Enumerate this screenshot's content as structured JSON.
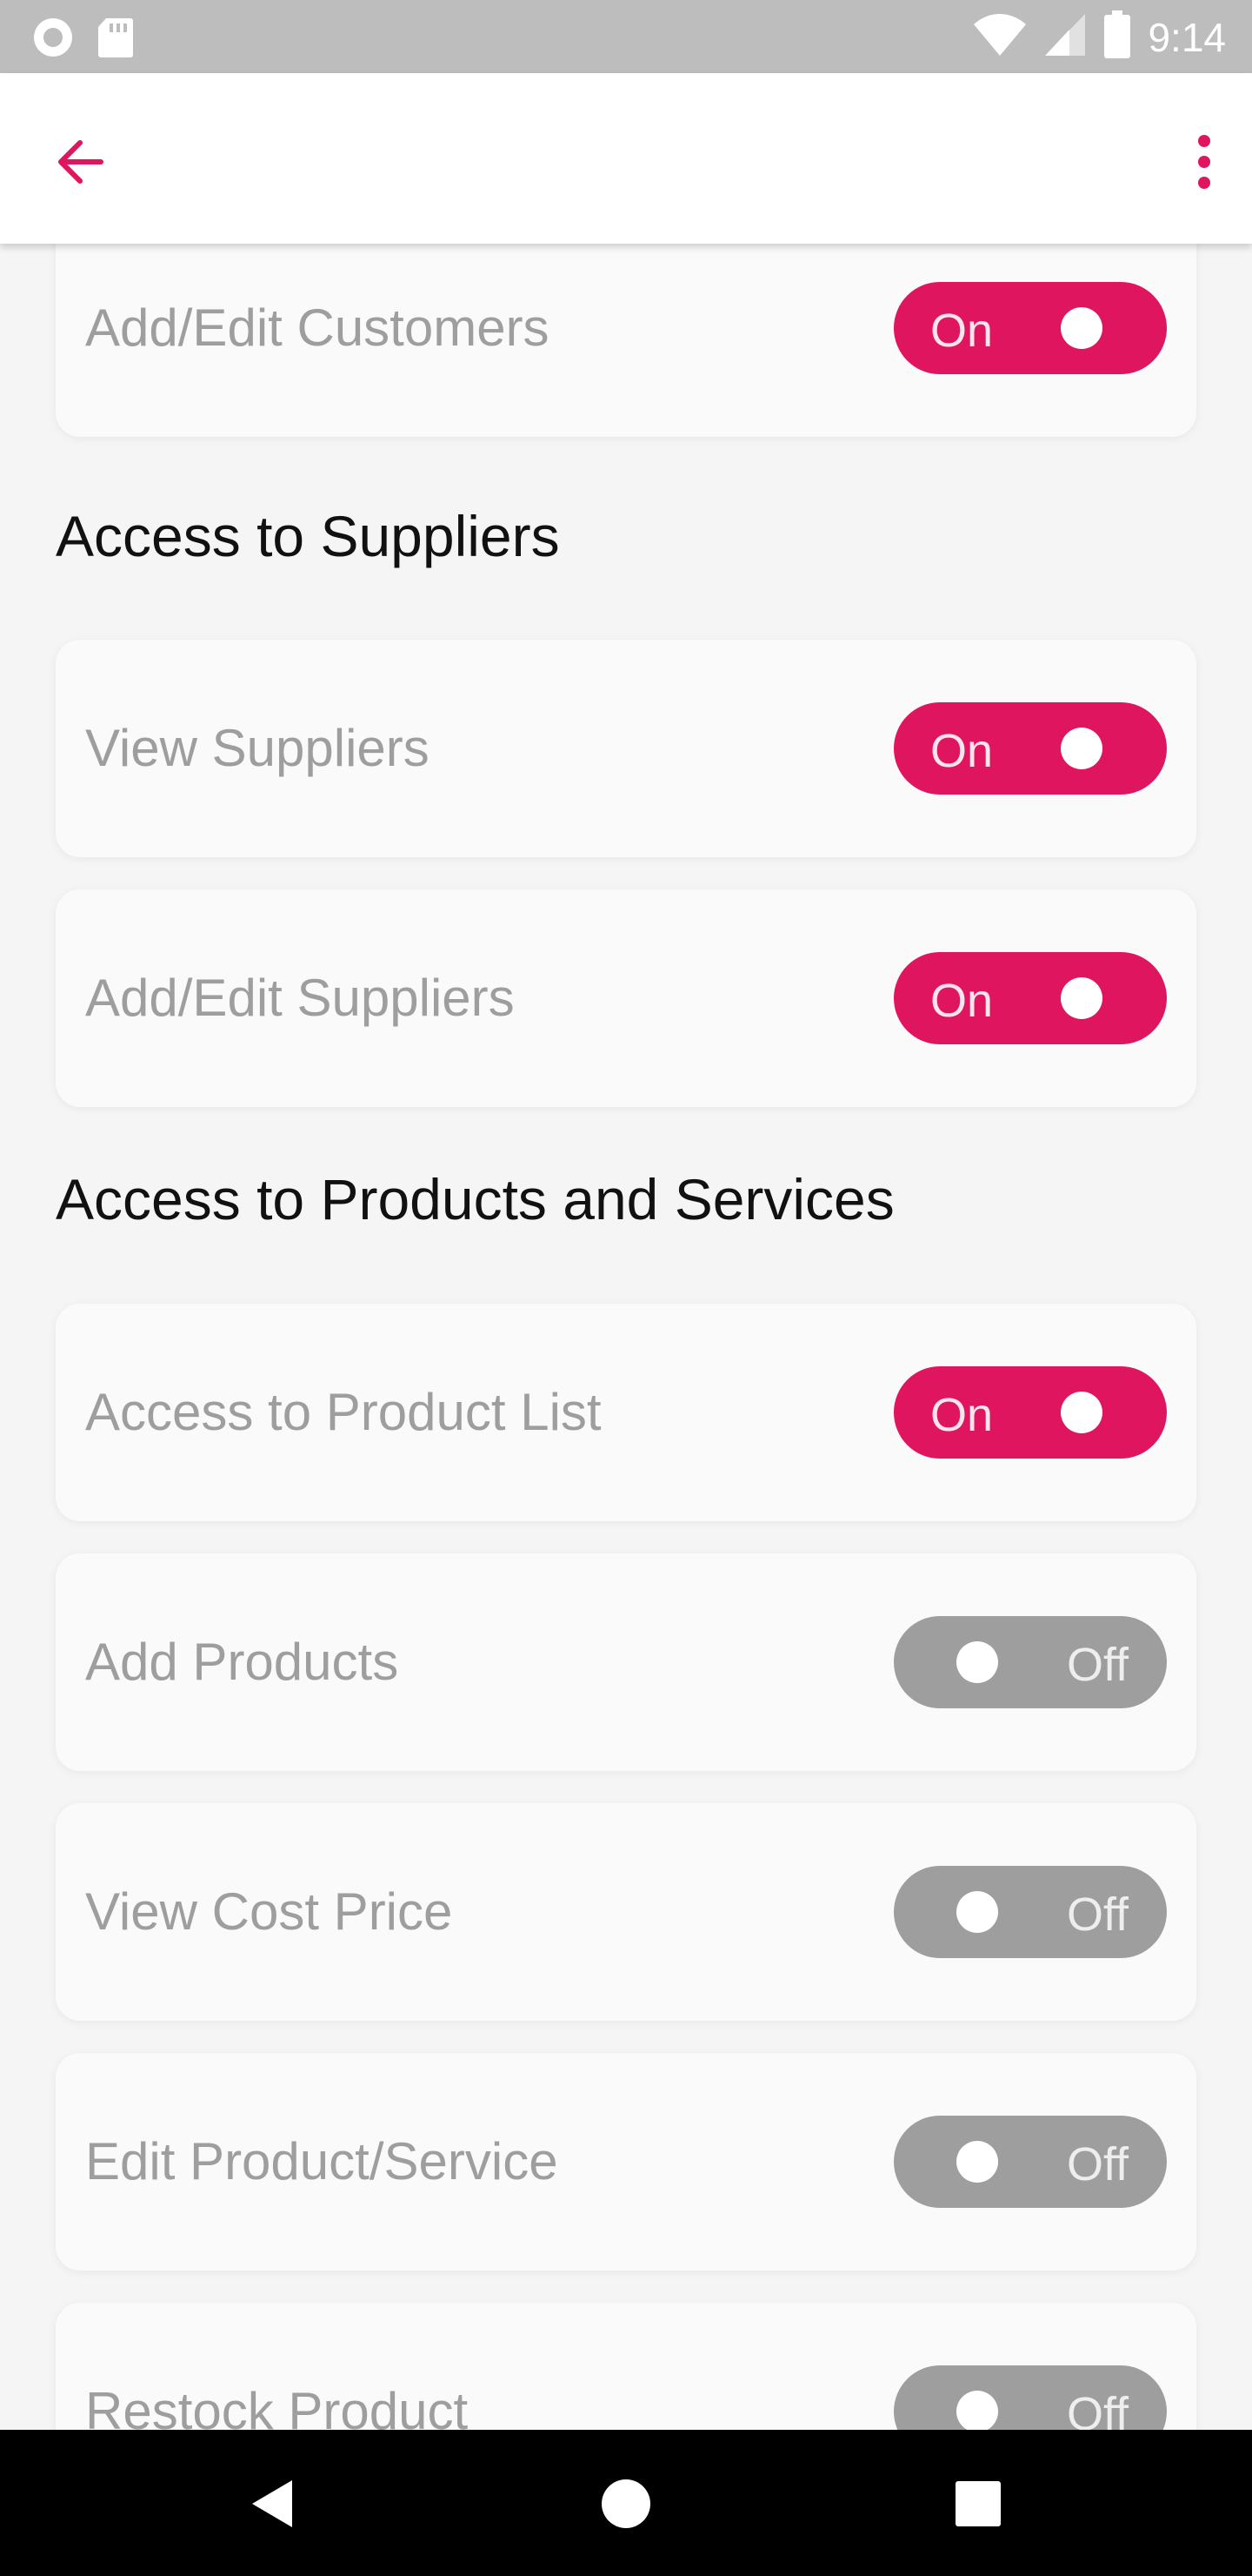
{
  "status_bar": {
    "time": "9:14",
    "icons": [
      "record-icon",
      "sd-card-icon",
      "wifi-icon",
      "signal-icon",
      "battery-icon"
    ]
  },
  "toolbar": {
    "back_icon": "arrow-left-icon",
    "menu_icon": "more-vert-icon",
    "accent_color": "#e0155f"
  },
  "sections": [
    {
      "header": "",
      "items": [
        {
          "label": "Add/Edit Customers",
          "state": "On",
          "enabled": true
        }
      ]
    },
    {
      "header": "Access to Suppliers",
      "items": [
        {
          "label": "View Suppliers",
          "state": "On",
          "enabled": true
        },
        {
          "label": "Add/Edit Suppliers",
          "state": "On",
          "enabled": true
        }
      ]
    },
    {
      "header": "Access to Products and Services",
      "items": [
        {
          "label": "Access to Product List",
          "state": "On",
          "enabled": true
        },
        {
          "label": "Add Products",
          "state": "Off",
          "enabled": false
        },
        {
          "label": "View Cost Price",
          "state": "Off",
          "enabled": false
        },
        {
          "label": "Edit Product/Service",
          "state": "Off",
          "enabled": false
        },
        {
          "label": "Restock Product",
          "state": "Off",
          "enabled": false
        }
      ]
    }
  ],
  "colors": {
    "toggle_on": "#e0155f",
    "toggle_off": "#9e9e9e",
    "label": "#9e9e9e",
    "section_header": "#111111"
  },
  "nav_bar": {
    "back_icon": "nav-back-icon",
    "home_icon": "nav-home-icon",
    "recents_icon": "nav-recents-icon"
  }
}
